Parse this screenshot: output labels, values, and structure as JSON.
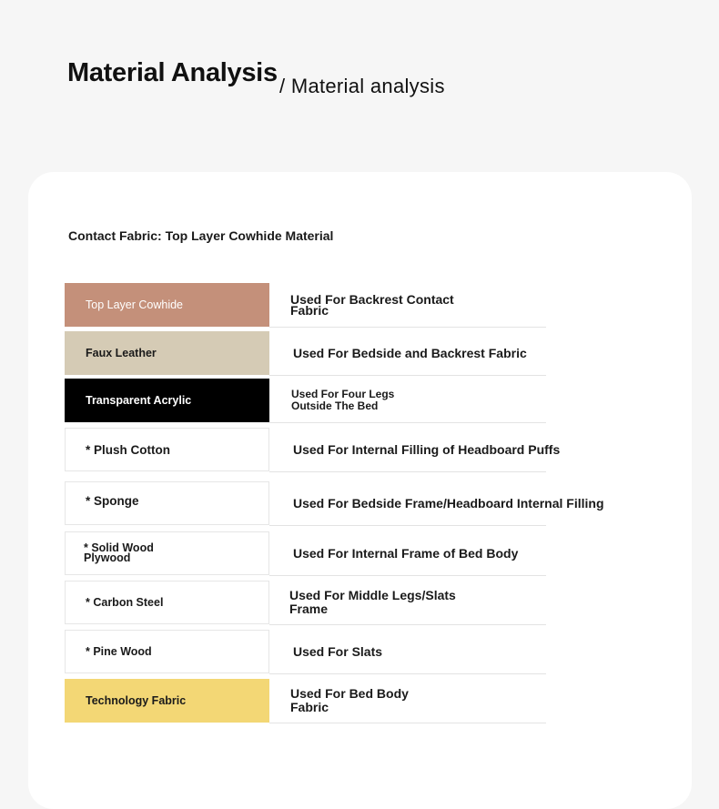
{
  "header": {
    "title": "Material Analysis",
    "subtitle": "/ Material analysis"
  },
  "contact_fabric": "Contact Fabric: Top Layer Cowhide Material",
  "materials": [
    {
      "name": "Top Layer Cowhide",
      "use": "Used For Backrest Contact Fabric",
      "color": "#c4907a",
      "text_color": "#ffffff"
    },
    {
      "name": "Faux Leather",
      "use": "Used For Bedside and Backrest Fabric",
      "color": "#d5cbb5",
      "text_color": "#1a1a1a"
    },
    {
      "name": "Transparent Acrylic",
      "use": "Used For Four Legs Outside The Bed",
      "color": "#000000",
      "text_color": "#ffffff"
    },
    {
      "name": "* Plush Cotton",
      "use": "Used For Internal Filling of Headboard Puffs",
      "color": "#ffffff",
      "text_color": "#1a1a1a"
    },
    {
      "name": "* Sponge",
      "use": "Used For Bedside Frame/Headboard Internal Filling",
      "color": "#ffffff",
      "text_color": "#1a1a1a"
    },
    {
      "name": "* Solid Wood Plywood",
      "use": "Used For Internal Frame of Bed Body",
      "color": "#ffffff",
      "text_color": "#1a1a1a"
    },
    {
      "name": "* Carbon Steel",
      "use": "Used For Middle Legs/Slats Frame",
      "color": "#ffffff",
      "text_color": "#1a1a1a"
    },
    {
      "name": "* Pine Wood",
      "use": "Used For Slats",
      "color": "#ffffff",
      "text_color": "#1a1a1a"
    },
    {
      "name": "Technology Fabric",
      "use": "Used For Bed Body Fabric",
      "color": "#f3d775",
      "text_color": "#1a1a1a"
    }
  ]
}
